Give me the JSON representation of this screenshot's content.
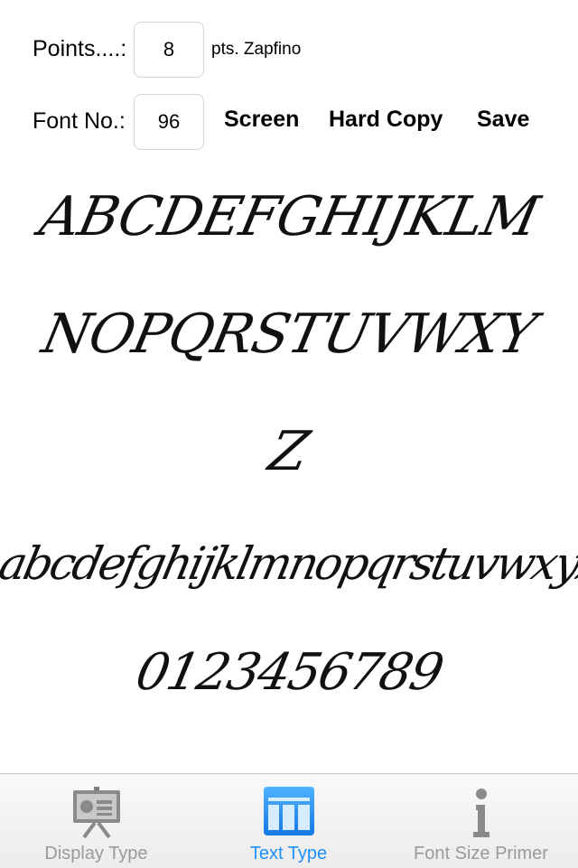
{
  "controls": {
    "points_label": "Points....:",
    "points_value": "8",
    "points_unit": "pts. Zapfino",
    "font_no_label": "Font No.:",
    "font_no_value": "96",
    "screen_button": "Screen",
    "hard_copy_button": "Hard Copy",
    "save_button": "Save"
  },
  "specimen": {
    "upper_line1": "ABCDEFGHIJKLM",
    "upper_line2": "NOPQRSTUVWXY",
    "upper_line3": "Z",
    "lowercase": "abcdefghijklmnopqrstuvwxyz",
    "digits": "0123456789"
  },
  "tabbar": {
    "active_color": "#1e90ff",
    "inactive_color": "#9a9a9a",
    "tabs": [
      {
        "label": "Display Type",
        "icon": "presentation-icon",
        "active": false
      },
      {
        "label": "Text Type",
        "icon": "table-icon",
        "active": true
      },
      {
        "label": "Font Size Primer",
        "icon": "info-icon",
        "active": false
      }
    ]
  }
}
